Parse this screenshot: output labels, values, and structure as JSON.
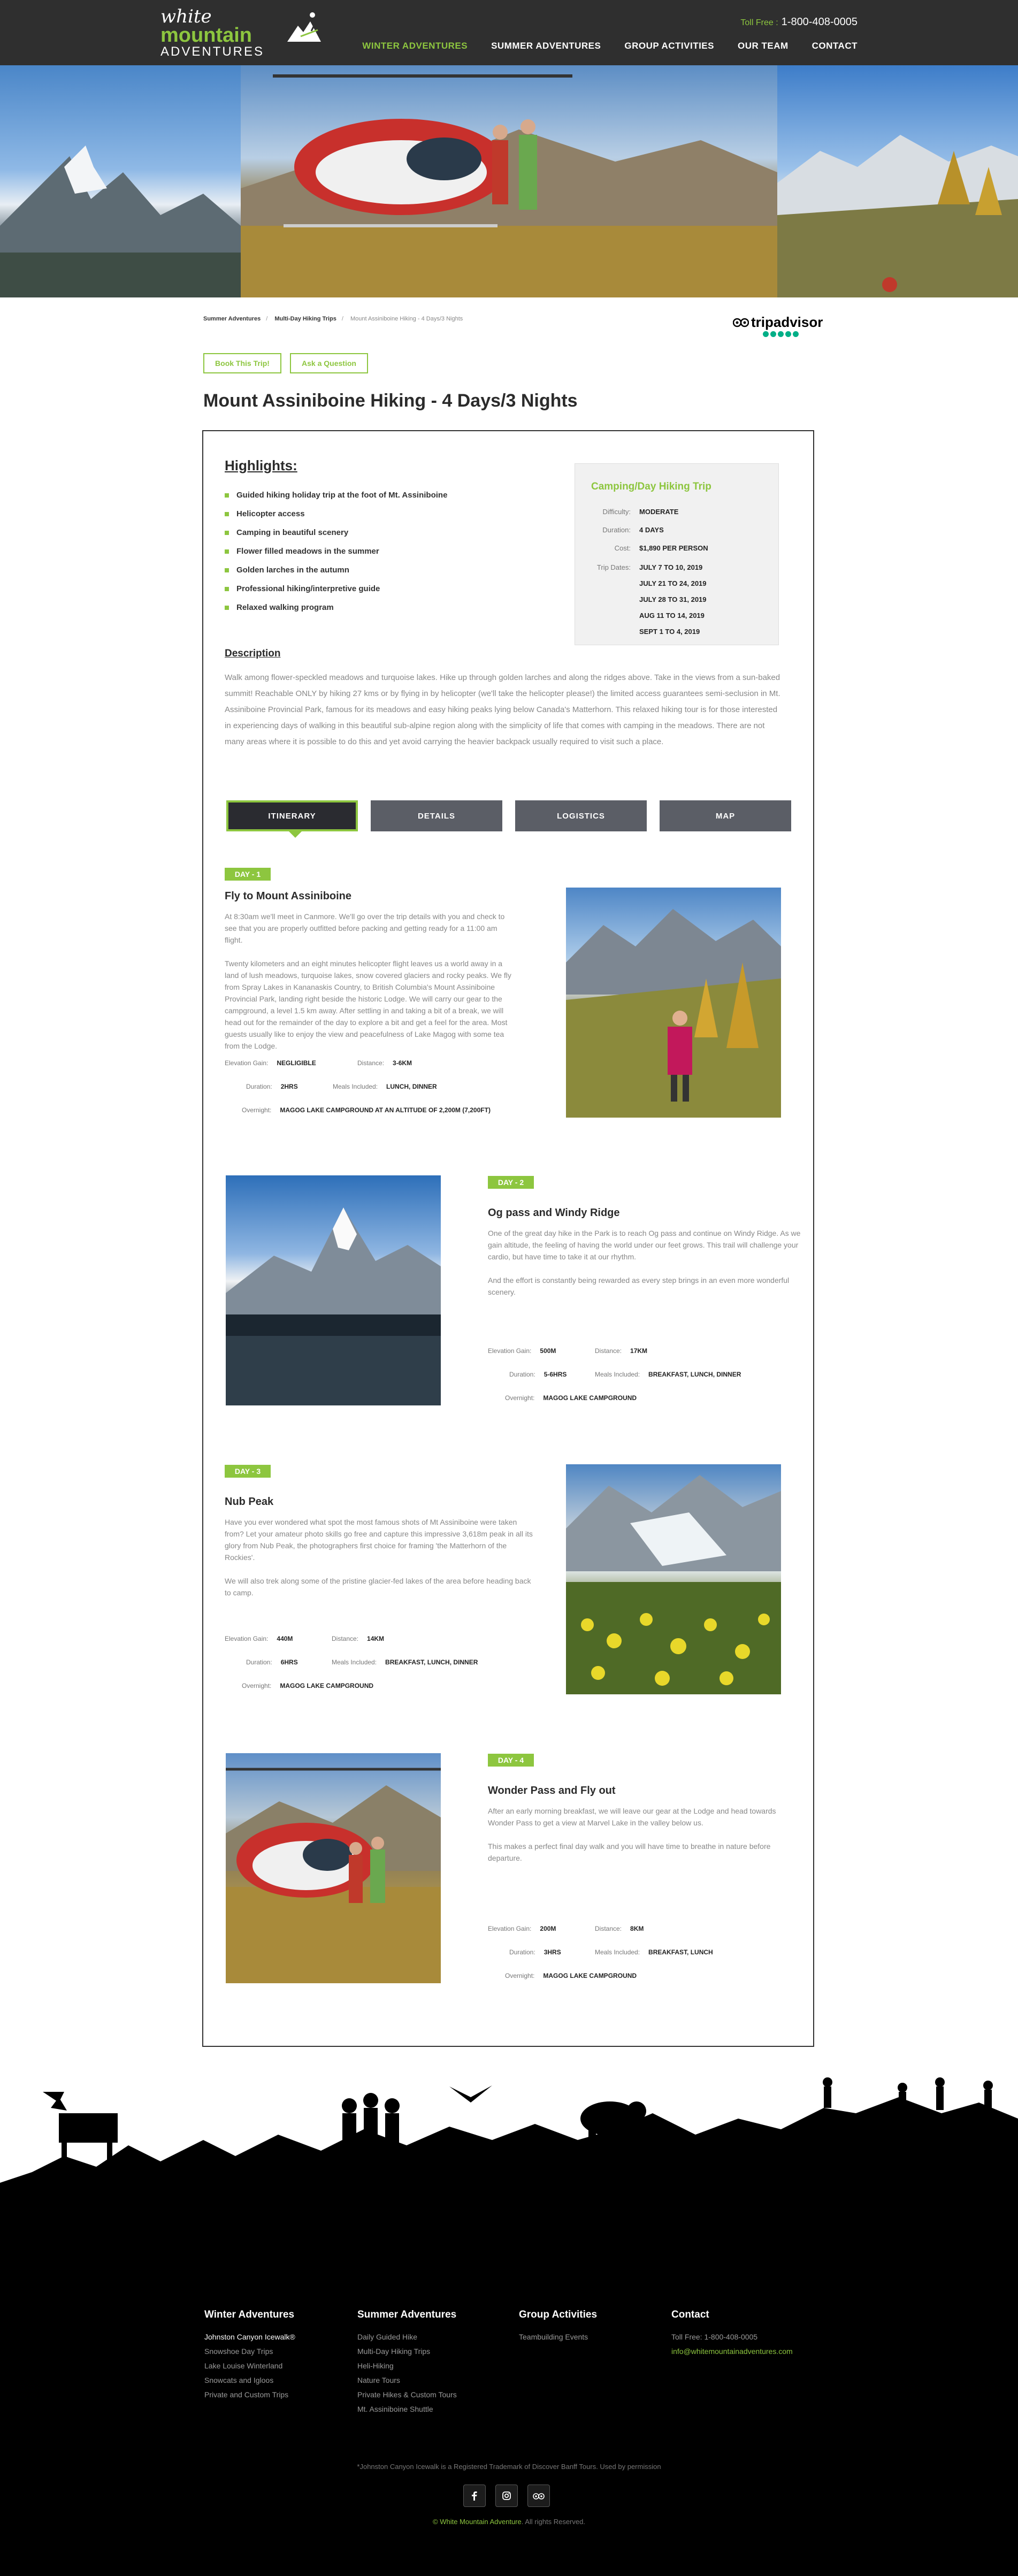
{
  "header": {
    "logo_line1": "white",
    "logo_line2": "mountain",
    "logo_line3": "ADVENTURES",
    "tollfree_label": "Toll Free :",
    "tollfree_number": "1-800-408-0005",
    "nav": [
      "WINTER ADVENTURES",
      "SUMMER ADVENTURES",
      "GROUP ACTIVITIES",
      "OUR TEAM",
      "CONTACT"
    ],
    "active_nav_index": 0
  },
  "breadcrumb": {
    "items": [
      "Summer Adventures",
      "Multi-Day Hiking Trips",
      "Mount Assiniboine Hiking - 4 Days/3 Nights"
    ],
    "separator": "/"
  },
  "tripadvisor": {
    "word": "tripadvisor",
    "rating_dots": 5
  },
  "actions": {
    "book": "Book This Trip!",
    "ask": "Ask a Question"
  },
  "page_title": "Mount Assiniboine Hiking - 4 Days/3 Nights",
  "highlights": {
    "title": "Highlights:",
    "items": [
      "Guided hiking holiday trip at the foot of Mt. Assiniboine",
      "Helicopter access",
      "Camping in beautiful scenery",
      "Flower filled meadows in the summer",
      "Golden larches in the autumn",
      "Professional hiking/interpretive guide",
      "Relaxed walking program"
    ]
  },
  "trip_card": {
    "title": "Camping/Day Hiking Trip",
    "difficulty_label": "Difficulty:",
    "difficulty": "MODERATE",
    "duration_label": "Duration:",
    "duration": "4 DAYS",
    "cost_label": "Cost:",
    "cost": "$1,890 PER PERSON",
    "dates_label": "Trip Dates:",
    "dates": [
      "JULY 7 TO 10, 2019",
      "JULY 21 TO 24, 2019",
      "JULY 28 TO 31, 2019",
      "AUG 11 TO 14, 2019",
      "SEPT 1 TO 4, 2019"
    ]
  },
  "description": {
    "title": "Description",
    "text": "Walk among flower-speckled meadows and turquoise lakes. Hike up through golden larches and along the ridges above. Take in the views from a sun-baked summit! Reachable ONLY by hiking 27 kms or by flying in by helicopter (we'll take the helicopter please!) the limited access guarantees semi-seclusion in Mt. Assiniboine Provincial Park, famous for its meadows and easy hiking peaks lying below Canada's Matterhorn. This relaxed hiking tour is for those interested in experiencing days of walking in this beautiful sub-alpine region along with the simplicity of life that comes with camping in the meadows. There are not many areas where it is possible to do this and yet avoid carrying the heavier backpack usually required to visit such a place."
  },
  "tabs": [
    "ITINERARY",
    "DETAILS",
    "LOGISTICS",
    "MAP"
  ],
  "labels": {
    "elevation": "Elevation Gain:",
    "distance": "Distance:",
    "duration": "Duration:",
    "meals": "Meals Included:",
    "overnight": "Overnight:"
  },
  "days": [
    {
      "badge": "DAY - 1",
      "title": "Fly to Mount Assiniboine",
      "paragraphs": [
        "At 8:30am we'll meet in  Canmore. We'll go over the trip details with you and check to see that you are properly outfitted before packing and getting ready for a 11:00 am flight.",
        "Twenty kilometers and an eight minutes helicopter flight leaves us a world away in a land of lush meadows, turquoise lakes, snow covered glaciers and rocky peaks. We fly from Spray Lakes in Kananaskis Country, to British Columbia's Mount Assiniboine Provincial Park, landing right beside the historic Lodge. We will carry our gear to the campground, a level 1.5 km away. After settling in and taking a bit of a break, we will head out for the remainder of the day to explore a bit and get a feel for the area. Most guests usually like to enjoy the view and peacefulness of Lake Magog with some tea from the Lodge."
      ],
      "elevation": "NEGLIGIBLE",
      "distance": "3-6KM",
      "duration": "2HRS",
      "meals": "LUNCH, DINNER",
      "overnight": "MAGOG LAKE CAMPGROUND AT AN ALTITUDE OF 2,200M (7,200FT)"
    },
    {
      "badge": "DAY - 2",
      "title": "Og pass and Windy Ridge",
      "paragraphs": [
        "One of the great day hike in the Park is to reach Og pass and continue on Windy Ridge. As we gain altitude, the feeling of having the world under our feet grows. This trail will challenge your cardio, but have time to take it at our rhythm.",
        "And the effort is constantly being rewarded as every step brings in an even more wonderful scenery."
      ],
      "elevation": "500M",
      "distance": "17KM",
      "duration": "5-6HRS",
      "meals": "BREAKFAST, LUNCH, DINNER",
      "overnight": "MAGOG LAKE CAMPGROUND"
    },
    {
      "badge": "DAY - 3",
      "title": "Nub Peak",
      "paragraphs": [
        "Have you ever wondered what spot the most famous shots of Mt Assiniboine were taken from? Let your amateur photo skills go free and capture this impressive 3,618m peak in all its glory from Nub Peak, the photographers first choice for framing 'the Matterhorn of the Rockies'.",
        "We will also trek along some of the pristine glacier-fed lakes of the area before heading back to camp."
      ],
      "elevation": "440M",
      "distance": "14KM",
      "duration": "6HRS",
      "meals": "BREAKFAST, LUNCH, DINNER",
      "overnight": "MAGOG LAKE CAMPGROUND"
    },
    {
      "badge": "DAY - 4",
      "title": "Wonder Pass and Fly out",
      "paragraphs": [
        "After an early morning breakfast, we will leave our gear at the Lodge and head towards Wonder Pass to get a view at Marvel Lake in the valley below us.",
        "This makes a perfect final day walk and you will have time to breathe in nature before departure."
      ],
      "elevation": "200M",
      "distance": "8KM",
      "duration": "3HRS",
      "meals": "BREAKFAST, LUNCH",
      "overnight": "MAGOG LAKE CAMPGROUND"
    }
  ],
  "footer": {
    "columns": [
      {
        "title": "Winter Adventures",
        "links": [
          "Johnston Canyon Icewalk®",
          "Snowshoe Day Trips",
          "Lake Louise Winterland",
          "Snowcats and Igloos",
          "Private and Custom Trips"
        ]
      },
      {
        "title": "Summer Adventures",
        "links": [
          "Daily Guided Hike",
          "Multi-Day Hiking Trips",
          "Heli-Hiking",
          "Nature Tours",
          "Private Hikes & Custom Tours",
          "Mt. Assiniboine Shuttle"
        ]
      },
      {
        "title": "Group Activities",
        "links": [
          "Teambuilding Events"
        ]
      },
      {
        "title": "Contact",
        "links": [
          "Toll Free: 1-800-408-0005",
          "info@whitemountainadventures.com"
        ]
      }
    ],
    "trademark": "*Johnston Canyon Icewalk is a Registered Trademark of Discover Banff Tours. Used by permission",
    "copyright_prefix": "©",
    "copyright_brand": "White Mountain Adventure",
    "copyright_suffix": ". All rights Reserved.",
    "social": [
      "facebook-icon",
      "instagram-icon",
      "tripadvisor-icon"
    ]
  },
  "colors": {
    "accent": "#8dc63f",
    "header_bg": "#2f2f2f",
    "footer_bg": "#000000",
    "tab_bg": "#5b5e66"
  }
}
